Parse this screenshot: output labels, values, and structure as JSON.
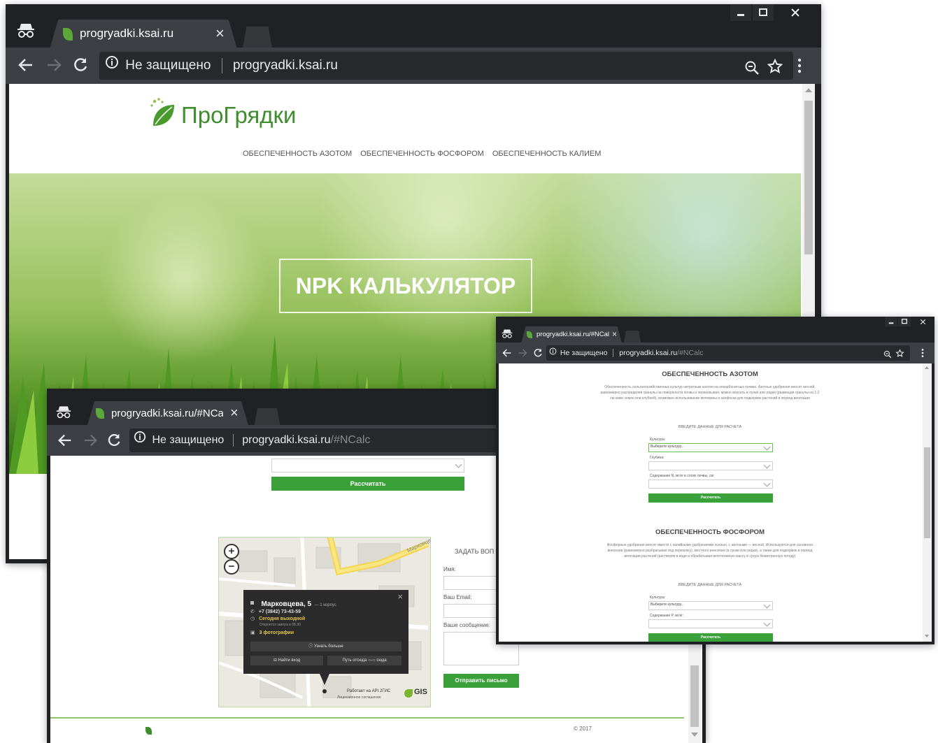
{
  "window_main": {
    "tab_title": "progryadki.ksai.ru",
    "security": "Не защищено",
    "url_host": "progryadki.ksai.ru",
    "url_path": "",
    "logo_text": "ПроГрядки",
    "nav": [
      "ОБЕСПЕЧЕННОСТЬ АЗОТОМ",
      "ОБЕСПЕЧЕННОСТЬ ФОСФОРОМ",
      "ОБЕСПЕЧЕННОСТЬ КАЛИЕМ"
    ],
    "hero_title": "NPK КАЛЬКУЛЯТОР"
  },
  "window_bottom": {
    "tab_title": "progryadki.ksai.ru/#NCalc",
    "security": "Не защищено",
    "url_host": "progryadki.ksai.ru",
    "url_path": "/#NCalc",
    "calc_button": "Рассчитать",
    "map": {
      "street": "Марковцева",
      "zoom_in": "+",
      "zoom_out": "−",
      "close": "×",
      "address": "Марковцева, 5",
      "address_sub": "— 1 корпус",
      "phone": "+7 (3842) 73-43-59",
      "status": "Сегодня выходной",
      "status_sub": "Откроется завтра в 08.30",
      "photos": "3 фотографии",
      "more": "Узнать больше",
      "find_entrance": "Найти вход",
      "route_prefix": "Путь отсюда",
      "route_suffix": "сюда",
      "powered": "Работает на API 2ГИС",
      "license": "Лицензионное соглашение",
      "gis": "GIS"
    },
    "form": {
      "heading": "ЗАДАТЬ ВОП",
      "name_label": "Имя:",
      "email_label": "Ваш Email:",
      "message_label": "Ваше сообщение:",
      "send_button": "Отправить письмо"
    },
    "footer_copy": "© 2017"
  },
  "window_right": {
    "tab_title": "progryadki.ksai.ru/#NCalc",
    "security": "Не защищено",
    "url_host": "progryadki.ksai.ru",
    "url_path": "/#NCalc",
    "nitrogen": {
      "heading": "ОБЕСПЕЧЕННОСТЬ АЗОТОМ",
      "paragraph": "Обеспеченность сельскохозяйственных культур нитратным азотом на некарбонатных почвах. Азотные удобрения вносят весной, равномерно распределяя гранулы на поверхности почвы и перекапывая, можно вносить в лунки или рядки (размещая гранулы на 1-2 см ниже семян или клубней), возможно использование мочевины и азофоски для подкормок растений в период вегетации",
      "subheading": "ВВЕДИТЕ ДАННЫЕ ДЛЯ РАСЧЕТА",
      "culture_label": "Культура:",
      "culture_value": "Выберите культуру...",
      "depth_label": "Глубина:",
      "content_label": "Содержание N, мг/кг в слоях почвы, см:",
      "button": "Рассчитать"
    },
    "phosphorus": {
      "heading": "ОБЕСПЕЧЕННОСТЬ ФОСФОРОМ",
      "paragraph": "Фосфорные удобрения вносят вместе с калийными удобрениями осенью, с азотными — весной. Используются для основного внесения (равномерно разбрасывая под перекопку), местного внесения (в лунки или рядки), а также для подкормок в период вегетации растений (растворяя в воде и обрабатывая вегетативную массу в сухую безветренную погоду)",
      "subheading": "ВВЕДИТЕ ДАННЫЕ ДЛЯ РАСЧЕТА",
      "culture_label": "Культура:",
      "culture_value": "Выберите культуру...",
      "content_label": "Содержание P, мг/кг:",
      "button": "Рассчитать"
    }
  },
  "colors": {
    "chrome_dark": "#202124",
    "chrome_toolbar": "#3c3f43",
    "brand_green": "#3aa13a",
    "logo_green": "#5da83a"
  },
  "icons": [
    "incognito-icon",
    "leaf-favicon-icon",
    "close-icon",
    "back-icon",
    "forward-icon",
    "reload-icon",
    "info-icon",
    "zoom-icon",
    "star-icon",
    "menu-icon",
    "minimize-icon",
    "maximize-icon"
  ]
}
